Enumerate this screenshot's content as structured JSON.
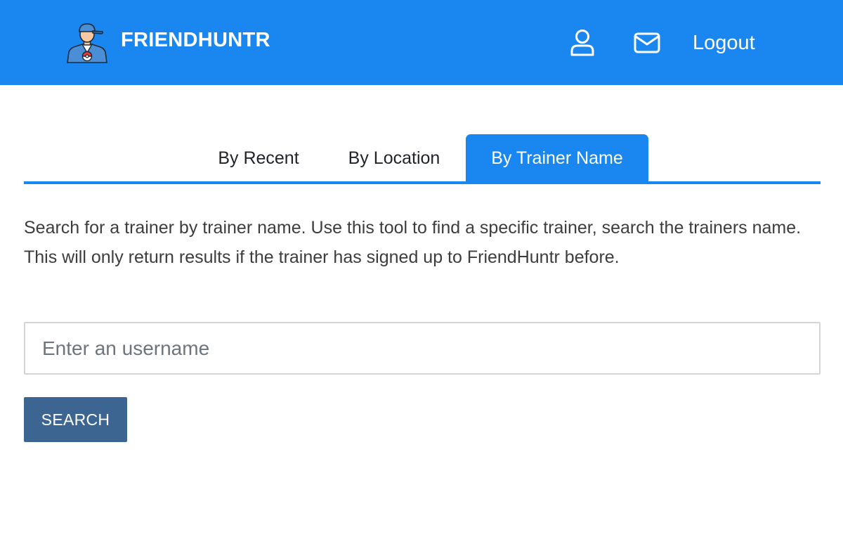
{
  "app": {
    "brand_name": "FRIENDHUNTR",
    "logo_icon": "trainer-avatar-icon"
  },
  "nav": {
    "profile_icon": "user-icon",
    "messages_icon": "envelope-icon",
    "logout_label": "Logout"
  },
  "tabs": [
    {
      "label": "By Recent",
      "active": false
    },
    {
      "label": "By Location",
      "active": false
    },
    {
      "label": "By Trainer Name",
      "active": true
    }
  ],
  "content": {
    "description": "Search for a trainer by trainer name. Use this tool to find a specific trainer, search the trainers name. This will only return results if the trainer has signed up to FriendHuntr before.",
    "search_input": {
      "placeholder": "Enter an username",
      "value": ""
    },
    "search_button_label": "SEARCH"
  },
  "colors": {
    "primary": "#1a87f0",
    "button": "#3c6591",
    "text": "#3d3d3d",
    "input_border": "#d3d6d9"
  }
}
